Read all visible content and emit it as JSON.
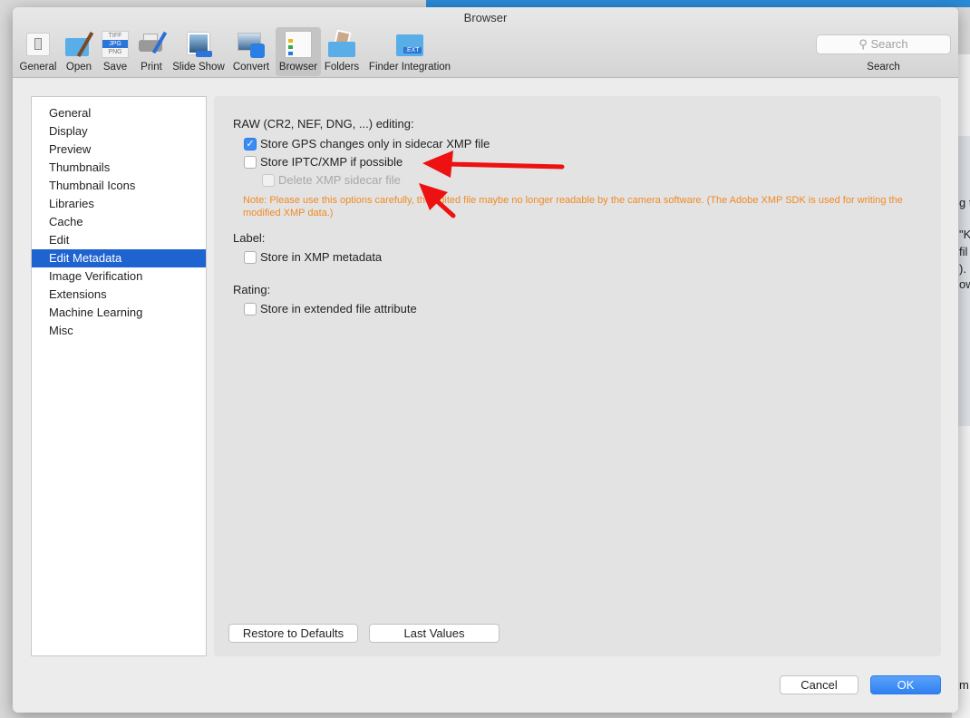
{
  "window": {
    "title": "Browser"
  },
  "toolbar": {
    "items": [
      {
        "label": "General",
        "icon": "switch-icon"
      },
      {
        "label": "Open",
        "icon": "folder-brush-icon"
      },
      {
        "label": "Save",
        "icon": "file-formats-icon",
        "formats": [
          "TIFF",
          "JPG",
          "PNG"
        ]
      },
      {
        "label": "Print",
        "icon": "printer-icon"
      },
      {
        "label": "Slide Show",
        "icon": "slideshow-icon"
      },
      {
        "label": "Convert",
        "icon": "convert-icon"
      },
      {
        "label": "Browser",
        "icon": "browser-icon",
        "selected": true
      },
      {
        "label": "Folders",
        "icon": "folders-icon"
      },
      {
        "label": "Finder Integration",
        "icon": "finder-ext-icon",
        "badge": ".EXT"
      }
    ],
    "search": {
      "placeholder": "Search",
      "label": "Search"
    }
  },
  "sidebar": {
    "items": [
      "General",
      "Display",
      "Preview",
      "Thumbnails",
      "Thumbnail Icons",
      "Libraries",
      "Cache",
      "Edit",
      "Edit Metadata",
      "Image Verification",
      "Extensions",
      "Machine Learning",
      "Misc"
    ],
    "selected": "Edit Metadata"
  },
  "main": {
    "raw_heading": "RAW (CR2, NEF, DNG, ...) editing:",
    "gps": {
      "label": "Store GPS changes only in sidecar XMP file",
      "checked": true
    },
    "iptc": {
      "label": "Store IPTC/XMP if possible",
      "checked": false
    },
    "delete_sidecar": {
      "label": "Delete XMP sidecar file",
      "checked": false,
      "disabled": true
    },
    "note": "Note: Please use this options carefully, the edited file maybe no longer readable by the camera software. (The Adobe XMP SDK is used for writing the modified XMP data.)",
    "label_heading": "Label:",
    "label_xmp": {
      "label": "Store in XMP metadata",
      "checked": false
    },
    "rating_heading": "Rating:",
    "rating_attr": {
      "label": "Store in extended file attribute",
      "checked": false
    },
    "restore_button": "Restore to Defaults",
    "last_values_button": "Last Values"
  },
  "footer": {
    "cancel": "Cancel",
    "ok": "OK"
  },
  "background_text": [
    "g t",
    "\"K",
    "fil",
    ").",
    "ow",
    "m"
  ],
  "colors": {
    "accent": "#1e63d0",
    "note": "#f08a24",
    "annotation_arrow": "#ee1111"
  }
}
